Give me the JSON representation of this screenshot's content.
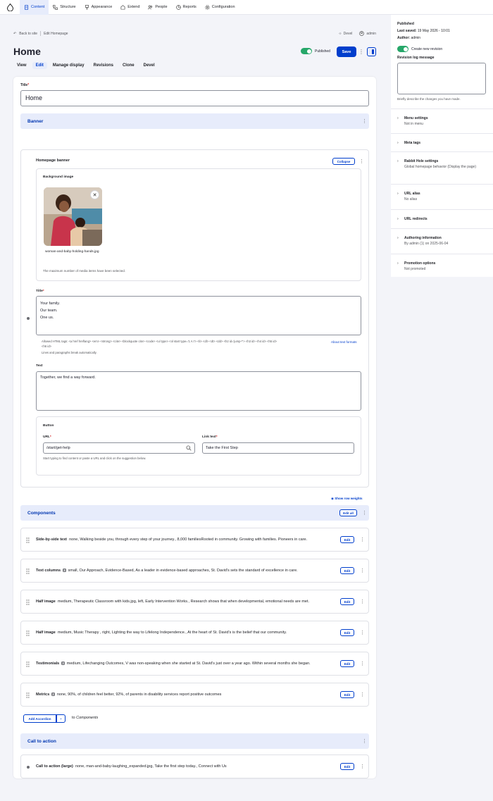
{
  "toolbar": {
    "items": [
      {
        "label": "Content",
        "icon": "document-icon",
        "active": true
      },
      {
        "label": "Structure",
        "icon": "structure-icon"
      },
      {
        "label": "Appearance",
        "icon": "brush-icon"
      },
      {
        "label": "Extend",
        "icon": "puzzle-icon"
      },
      {
        "label": "People",
        "icon": "people-icon"
      },
      {
        "label": "Reports",
        "icon": "chart-icon"
      },
      {
        "label": "Configuration",
        "icon": "gear-icon"
      }
    ]
  },
  "header": {
    "back_label": "Back to site",
    "crumb_label": "Edit Homepage",
    "devel_label": "Devel",
    "user_label": "admin",
    "page_title": "Home",
    "status_label": "Published",
    "save_label": "Save"
  },
  "tabs": [
    "View",
    "Edit",
    "Manage display",
    "Revisions",
    "Clone",
    "Devel"
  ],
  "form": {
    "title_label": "Title",
    "title_value": "Home",
    "banner_section": "Banner",
    "homepage_banner_label": "Homepage banner",
    "collapse_label": "Collapse",
    "background_image_label": "Background image",
    "image_filename": "woman-and-baby-holding-hands.jpg",
    "max_media_note": "The maximum number of media items have been selected.",
    "banner_title_label": "Title",
    "banner_title_lines": [
      "Your family.",
      "Our team.",
      "One us."
    ],
    "allowed_tags": "Allowed HTML tags: <a href hreflang> <em> <strong> <cite> <blockquote cite> <code> <ul type> <ol start type='1 A I'> <li> <dl> <dt> <dd> <h2 id='jump-*'> <h3 id> <h4 id> <h5 id> <h6 id>",
    "line_break_note": "Lines and paragraphs break automatically.",
    "about_formats": "About text formats",
    "text_label": "Text",
    "text_value": "Together, we find a way forward.",
    "button_label": "Button",
    "url_label": "URL",
    "url_value": "/start/get-help",
    "url_help": "Start typing to find content or paste a URL and click on the suggestion below.",
    "link_text_label": "Link text",
    "link_text_value": "Take the First Step",
    "show_row_weights": "Show row weights",
    "components_section": "Components",
    "edit_all_label": "Edit all",
    "edit_label": "Edit",
    "components": [
      {
        "type": "Side-by-side text",
        "badge": "",
        "summary": "none, Walking beside you, through every step of your journey., 8,000 familiesRooted in community. Growing with families. Pioneers in care."
      },
      {
        "type": "Text columns",
        "badge": "3",
        "summary": "small, Our Approach, Evidence-Based, As a leader in evidence-based approaches, St. David's sets the standard of excellence in care."
      },
      {
        "type": "Half image",
        "badge": "",
        "summary": "medium, Therapeutic Classroom with kids.jpg, left, Early Intervention Works., Research shows that when developmental, emotional needs are met."
      },
      {
        "type": "Half image",
        "badge": "",
        "summary": "medium, Music Therapy , right, Lighting the way to Lifelong Independence., At the heart of St. David's is the belief that our community."
      },
      {
        "type": "Testimonials",
        "badge": "3",
        "summary": "medium, Lifechanging Outcomes, V was non-speaking when she started at St. David's just over a year ago. Within several months she began."
      },
      {
        "type": "Metrics",
        "badge": "2",
        "summary": "none, 90%, of children feel better, 92%, of parents in disability services report positive outcomes"
      }
    ],
    "add_accordion_label": "Add Accordion",
    "to_label": "to",
    "to_target": "Components",
    "cta_section": "Call to action",
    "cta_row": {
      "type": "Call to action (large)",
      "summary": "none, man-and-baby-laughing_expanded.jpg, Take the first step today., Connect with Us"
    }
  },
  "sidebar": {
    "published": "Published",
    "last_saved_label": "Last saved:",
    "last_saved_value": "19 May 2026 - 10:01",
    "author_label": "Author:",
    "author_value": "admin",
    "create_revision": "Create new revision",
    "revision_log_label": "Revision log message",
    "revision_help": "Briefly describe the changes you have made.",
    "sections": [
      {
        "title": "Menu settings",
        "summary": "Not in menu"
      },
      {
        "title": "Meta tags",
        "summary": ""
      },
      {
        "title": "Rabbit Hole settings",
        "summary": "Global homepage behavior (Display the page)"
      },
      {
        "title": "URL alias",
        "summary": "No alias"
      },
      {
        "title": "URL redirects",
        "summary": ""
      },
      {
        "title": "Authoring information",
        "summary": "By admin (1) on 2025-06-04"
      },
      {
        "title": "Promotion options",
        "summary": "Not promoted"
      }
    ]
  },
  "colors": {
    "accent": "#003ecc",
    "section_bg": "#e7ecfb",
    "published_green": "#26a769",
    "page_bg": "#f3f4f9"
  }
}
